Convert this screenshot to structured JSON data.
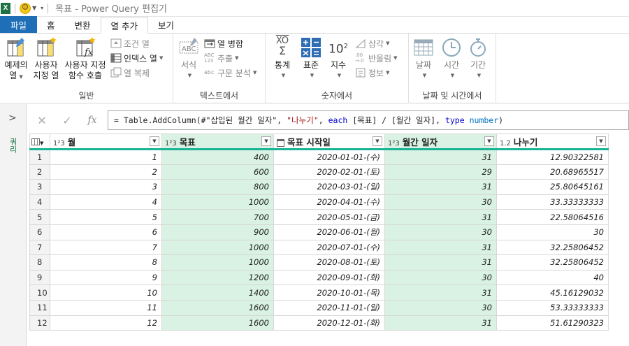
{
  "window": {
    "app_icon": "X",
    "title": "목표 - Power Query 편집기"
  },
  "tabs": [
    {
      "label": "파일"
    },
    {
      "label": "홈"
    },
    {
      "label": "변환"
    },
    {
      "label": "열 추가"
    },
    {
      "label": "보기"
    }
  ],
  "ribbon": {
    "general": {
      "label": "일반",
      "example_col": [
        "예제의",
        "열"
      ],
      "custom_col": [
        "사용자",
        "지정 열"
      ],
      "invoke_fn": [
        "사용자 지정",
        "함수 호출"
      ],
      "conditional": "조건 열",
      "index": "인덱스 열",
      "duplicate": "열 복제"
    },
    "text": {
      "label": "텍스트에서",
      "format": "서식",
      "merge": "열 병합",
      "extract": "추출",
      "parse": "구문 분석",
      "abc_small": "ABC",
      "num_small": "123",
      "abc_lower": "abc"
    },
    "number": {
      "label": "숫자에서",
      "stats": "통계",
      "standard": "표준",
      "scientific": "지수",
      "trig": "삼각",
      "round": "반올림",
      "info": "정보",
      "sigma_top": "XO",
      "sigma": "Σ",
      "pow": "10"
    },
    "datetime": {
      "label": "날짜 및 시간에서",
      "date": "날짜",
      "time": "시간",
      "duration": "기간"
    }
  },
  "sidebar": {
    "toggle": ">",
    "label": "쿼리"
  },
  "formula": {
    "cancel": "✕",
    "commit": "✓",
    "fx": "fx",
    "prefix": "= Table.AddColumn(#\"삽입된 월간 일자\", ",
    "str1": "\"나누기\"",
    "mid1": ", ",
    "kw1": "each",
    "mid2": " [목표] / [월간 일자], ",
    "kw2": "type",
    "sp": " ",
    "ty": "number",
    "end": ")"
  },
  "table": {
    "columns": [
      {
        "type": "1²3",
        "name": "월"
      },
      {
        "type": "1²3",
        "name": "목표"
      },
      {
        "type": "",
        "name": "목표 시작일"
      },
      {
        "type": "1²3",
        "name": "월간 일자"
      },
      {
        "type": "1.2",
        "name": "나누기"
      }
    ],
    "rows": [
      [
        "1",
        "1",
        "400",
        "2020-01-01-(수)",
        "31",
        "12.90322581"
      ],
      [
        "2",
        "2",
        "600",
        "2020-02-01-(토)",
        "29",
        "20.68965517"
      ],
      [
        "3",
        "3",
        "800",
        "2020-03-01-(일)",
        "31",
        "25.80645161"
      ],
      [
        "4",
        "4",
        "1000",
        "2020-04-01-(수)",
        "30",
        "33.33333333"
      ],
      [
        "5",
        "5",
        "700",
        "2020-05-01-(금)",
        "31",
        "22.58064516"
      ],
      [
        "6",
        "6",
        "900",
        "2020-06-01-(월)",
        "30",
        "30"
      ],
      [
        "7",
        "7",
        "1000",
        "2020-07-01-(수)",
        "31",
        "32.25806452"
      ],
      [
        "8",
        "8",
        "1000",
        "2020-08-01-(토)",
        "31",
        "32.25806452"
      ],
      [
        "9",
        "9",
        "1200",
        "2020-09-01-(화)",
        "30",
        "40"
      ],
      [
        "10",
        "10",
        "1400",
        "2020-10-01-(목)",
        "31",
        "45.16129032"
      ],
      [
        "11",
        "11",
        "1600",
        "2020-11-01-(일)",
        "30",
        "53.33333333"
      ],
      [
        "12",
        "12",
        "1600",
        "2020-12-01-(화)",
        "31",
        "51.61290323"
      ]
    ]
  }
}
